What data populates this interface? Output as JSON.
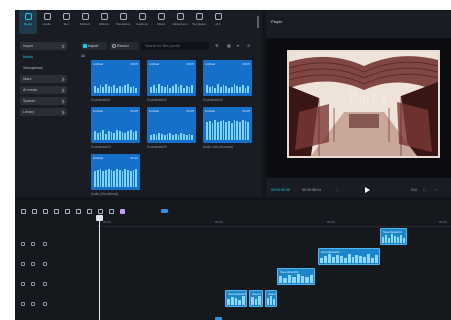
{
  "toolbar": {
    "items": [
      {
        "label": "Media",
        "icon": "media-icon",
        "active": true
      },
      {
        "label": "Audio",
        "icon": "audio-icon"
      },
      {
        "label": "Text",
        "icon": "text-icon"
      },
      {
        "label": "Stickers",
        "icon": "stickers-icon"
      },
      {
        "label": "Effects",
        "icon": "effects-icon"
      },
      {
        "label": "Transitions",
        "icon": "transitions-icon"
      },
      {
        "label": "Captions",
        "icon": "captions-icon"
      },
      {
        "label": "Filters",
        "icon": "filters-icon"
      },
      {
        "label": "Adjustment",
        "icon": "adjustment-icon"
      },
      {
        "label": "Templates",
        "icon": "templates-icon"
      },
      {
        "label": "AI A",
        "icon": "ai-icon"
      }
    ]
  },
  "sidebar": {
    "items": [
      {
        "label": "Import",
        "boxed": true
      },
      {
        "label": "Media",
        "active": true
      },
      {
        "label": "Subcaptions"
      },
      {
        "label": "Stars",
        "boxed": true
      },
      {
        "label": "AI media",
        "boxed": true
      },
      {
        "label": "Spaces",
        "boxed": true
      },
      {
        "label": "Library",
        "boxed": true
      }
    ]
  },
  "media": {
    "import_label": "Import",
    "record_label": "Record",
    "search_placeholder": "Search for files (local)",
    "section_label": "All",
    "thumbs": [
      {
        "name": "Untitled",
        "duration": "00:05",
        "caption": "Soundtrack01"
      },
      {
        "name": "Untitled",
        "duration": "00:05",
        "caption": "Soundtrack02"
      },
      {
        "name": "Untitled",
        "duration": "00:05",
        "caption": "Soundtrack03"
      },
      {
        "name": "Untitled",
        "duration": "00:05",
        "caption": "Soundtrack04"
      },
      {
        "name": "Untitled",
        "duration": "00:05",
        "caption": "Soundtrack05"
      },
      {
        "name": "Untitled",
        "duration": "00:05",
        "caption": "Audio.m4a (Acoustic)"
      },
      {
        "name": "Untitled",
        "duration": "00:10",
        "caption": "Audio (Soundtrack)"
      }
    ]
  },
  "player": {
    "title": "Player",
    "overlay_text": "Part I",
    "current_time": "00:00:00:00",
    "total_time": "00:00:58:24",
    "ratio": "Full",
    "controls": [
      "Full",
      "⤧",
      "Ratio"
    ]
  },
  "timeline": {
    "ticks": [
      "00:00",
      "00:00",
      "00:00",
      "00:00",
      "00:00"
    ],
    "clips": [
      {
        "label": "Soundtrack04",
        "bars": [
          6,
          8,
          5,
          9,
          7,
          6,
          8,
          5
        ]
      },
      {
        "label": "Soundtrack03",
        "bars": [
          5,
          7,
          9,
          6,
          8,
          7,
          5,
          9,
          6,
          8,
          7,
          6,
          9,
          5,
          8
        ]
      },
      {
        "label": "Soundtrack02",
        "bars": [
          7,
          5,
          8,
          6,
          9,
          7,
          6,
          8
        ]
      },
      {
        "label": "Soundtrack01",
        "bars": [
          6,
          8,
          7,
          5,
          9
        ]
      },
      {
        "label": "Sound",
        "bars": [
          8,
          6,
          9
        ]
      },
      {
        "label": "Sound",
        "bars": [
          7,
          9,
          6
        ]
      }
    ]
  },
  "colors": {
    "accent": "#27c7e4",
    "clip": "#1b86c9",
    "thumb": "#1570c9",
    "background": "#121419"
  }
}
